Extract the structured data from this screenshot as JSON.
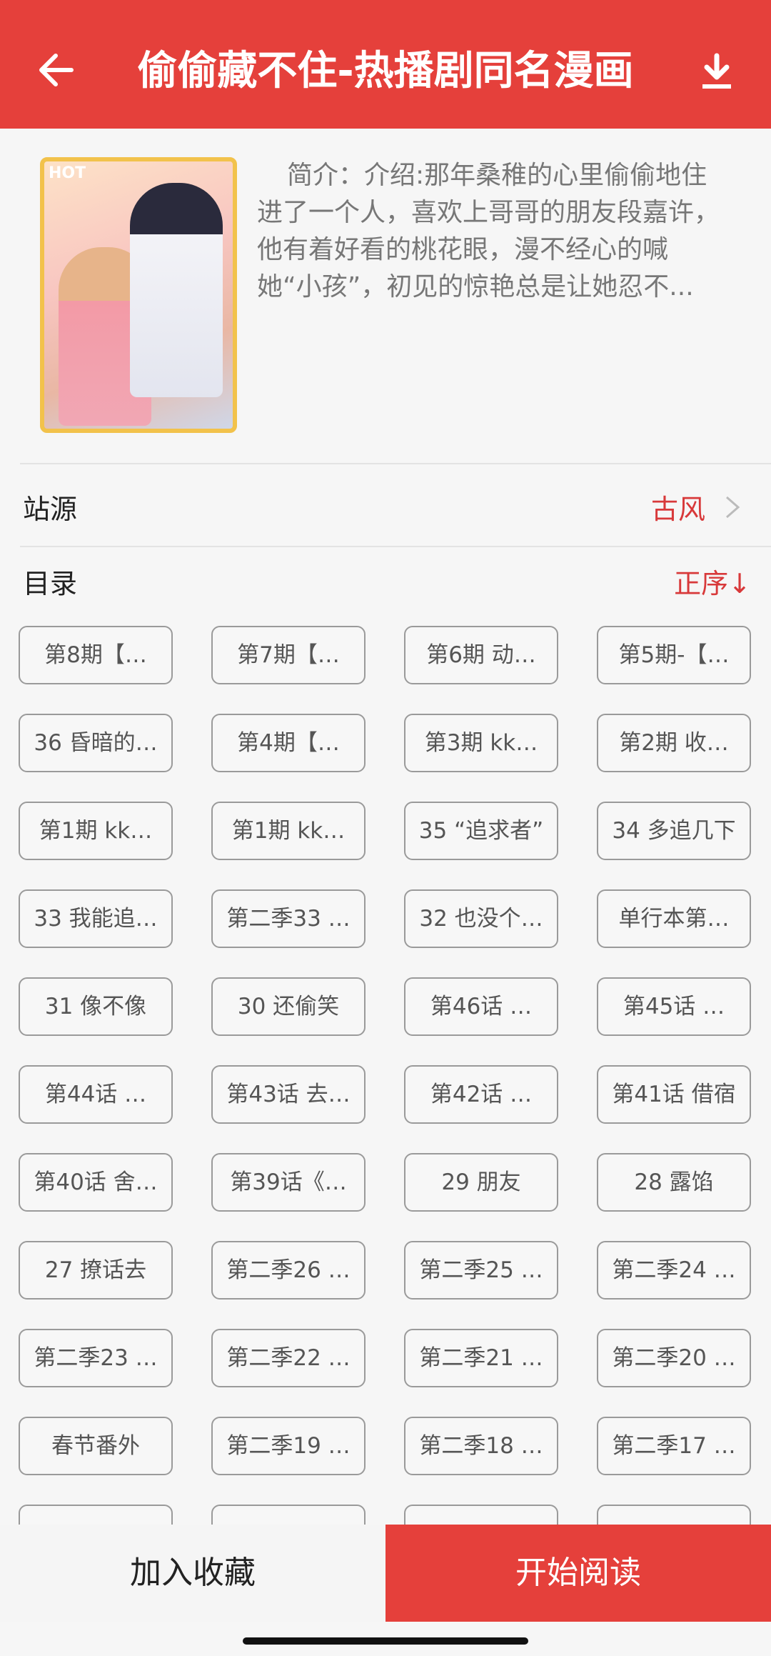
{
  "header": {
    "title": "偷偷藏不住-热播剧同名漫画",
    "back_icon": "back-arrow-icon",
    "download_icon": "download-icon",
    "bg_color": "#e5403b"
  },
  "intro": {
    "cover_badge": "HOT",
    "text": "简介：介绍:那年桑稚的心里偷偷地住进了一个人，喜欢上哥哥的朋友段嘉许，他有着好看的桃花眼，漫不经心的喊她“小孩”，初见的惊艳总是让她忍不..."
  },
  "source": {
    "label": "站源",
    "value": "古风"
  },
  "catalog": {
    "label": "目录",
    "sort_label": "正序↓",
    "chapters": [
      "第8期【…",
      "第7期【…",
      "第6期 动…",
      "第5期-【…",
      "36 昏暗的…",
      "第4期【…",
      "第3期 kk…",
      "第2期 收…",
      "第1期 kk…",
      "第1期 kk…",
      "35 “追求者”",
      "34 多追几下",
      "33 我能追…",
      "第二季33 …",
      "32 也没个…",
      "单行本第…",
      "31 像不像",
      "30 还偷笑",
      "第46话 …",
      "第45话 …",
      "第44话 …",
      "第43话 去…",
      "第42话 …",
      "第41话 借宿",
      "第40话 舍…",
      "第39话《…",
      "29 朋友",
      "28 露馅",
      "27 撩话去",
      "第二季26 …",
      "第二季25 …",
      "第二季24 …",
      "第二季23 …",
      "第二季22 …",
      "第二季21 …",
      "第二季20 …",
      "春节番外",
      "第二季19 …",
      "第二季18 …",
      "第二季17 …",
      "",
      "",
      "",
      ""
    ]
  },
  "bottom": {
    "favorite_label": "加入收藏",
    "read_label": "开始阅读"
  }
}
